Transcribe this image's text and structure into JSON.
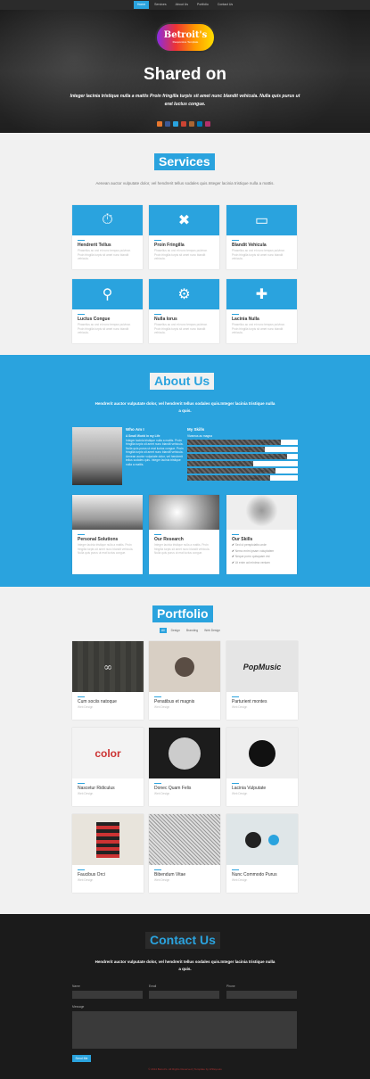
{
  "nav": {
    "items": [
      "Home",
      "Services",
      "About Us",
      "Portfolio",
      "Contact Us"
    ]
  },
  "hero": {
    "logo_text": "Betroit's",
    "logo_sub": "Responsive Template",
    "title": "Shared on",
    "text": "Integer lacinia tristique nulla a mattis Proin fringilla turpis sit amet nunc blandit vehicula. Nulla quis purus ut erat luctus congue."
  },
  "services": {
    "title": "Services",
    "subtitle": "Aenean auctor vulputate dolor, vel hendrerit tellus sodales quis.Integer lacinia tristique nulla a mattis.",
    "items": [
      {
        "icon": "stopwatch-icon",
        "title": "Hendrerit Tellus",
        "desc": "Phasellus ac orci et nunc tempus pulvinar. Proin fringilla turpis sit amet nunc blandit vehicula."
      },
      {
        "icon": "tools-icon",
        "title": "Proin Fringilla",
        "desc": "Phasellus ac orci et nunc tempus pulvinar. Proin fringilla turpis sit amet nunc blandit vehicula."
      },
      {
        "icon": "tablet-icon",
        "title": "Blandit Vehicula",
        "desc": "Phasellus ac orci et nunc tempus pulvinar. Proin fringilla turpis sit amet nunc blandit vehicula."
      },
      {
        "icon": "magnifier-icon",
        "title": "Luctus Congue",
        "desc": "Phasellus ac orci et nunc tempus pulvinar. Proin fringilla turpis sit amet nunc blandit vehicula."
      },
      {
        "icon": "gears-icon",
        "title": "Nulla lorus",
        "desc": "Phasellus ac orci et nunc tempus pulvinar. Proin fringilla turpis sit amet nunc blandit vehicula."
      },
      {
        "icon": "puzzle-icon",
        "title": "Lacinia Nulla",
        "desc": "Phasellus ac orci et nunc tempus pulvinar. Proin fringilla turpis sit amet nunc blandit vehicula."
      }
    ]
  },
  "about": {
    "title": "About Us",
    "subtitle": "Hendrerit auctor vulputate dolor, vel hendrerit tellus sodales quis.Integer lacinia tristique nulla a quis.",
    "who_title": "Who Am I",
    "who_sub": "A Small World in my Life",
    "who_text": "Integer lacinia tristique nulla a mattis. Proin fringilla turpis sit amet nunc blandit vehicula. Nulla quis purus ut erat luctus congue. Proin fringilla turpis sit amet nunc blandit vehicula. Aenean auctor vulputate dolor, vel hendrerit tellus sodales quis. Integer lacinia tristique nulla a mattis.",
    "skills_title": "My Skills",
    "skills_sub": "Vivamus ac magna",
    "skills": [
      {
        "label": "HTML5",
        "value": 85
      },
      {
        "label": "CSS3",
        "value": 70
      },
      {
        "label": "Photoshop",
        "value": 90
      },
      {
        "label": "jQuery",
        "value": 60
      },
      {
        "label": "WordPress",
        "value": 80
      },
      {
        "label": "Design",
        "value": 75
      }
    ],
    "cards": [
      {
        "title": "Personal Solutions",
        "desc": "Integer lacinia tristique nulla a mattis. Proin fringilla turpis sit amet nunc blandit vehicula. Nulla quis purus ut erat luctus congue."
      },
      {
        "title": "Our Research",
        "desc": "Integer lacinia tristique nulla a mattis. Proin fringilla turpis sit amet nunc blandit vehicula. Nulla quis purus ut erat luctus congue."
      },
      {
        "title": "Our Skills",
        "items": [
          "Sed ut perspiciatis unde",
          "Nemo enim ipsam voluptatem",
          "Neque porro quisquam est",
          "Ut enim ad minima veniam",
          "Quis autem vel eum iure"
        ]
      }
    ]
  },
  "portfolio": {
    "title": "Portfolio",
    "filters": [
      "All",
      "Design",
      "Branding",
      "Web Design"
    ],
    "items": [
      {
        "title": "Cum sociis natoque",
        "tag": "Web Design"
      },
      {
        "title": "Penatibus et magnis",
        "tag": "Web Design"
      },
      {
        "title": "Parturient montes",
        "tag": "Web Design"
      },
      {
        "title": "Nascetur Ridiculus",
        "tag": "Web Design"
      },
      {
        "title": "Donec Quam Felis",
        "tag": "Web Design"
      },
      {
        "title": "Lacinia Vulputate",
        "tag": "Web Design"
      },
      {
        "title": "Faucibus Orci",
        "tag": "Web Design"
      },
      {
        "title": "Bibendum Vitae",
        "tag": "Web Design"
      },
      {
        "title": "Nunc Commodo Purus",
        "tag": "Web Design"
      }
    ]
  },
  "contact": {
    "title": "Contact Us",
    "subtitle": "Hendrerit auctor vulputate dolor, vel hendrerit tellus sodales quis.Integer lacinia tristique nulla a quis.",
    "name_label": "Name",
    "email_label": "Email",
    "phone_label": "Phone",
    "message_label": "Message",
    "send_label": "Send Me",
    "footer": "© 2014 Betroit's. All Rights Reserved | Template by W3layouts"
  },
  "colors": {
    "accent": "#2aa3de",
    "dark": "#1b1b1b"
  }
}
